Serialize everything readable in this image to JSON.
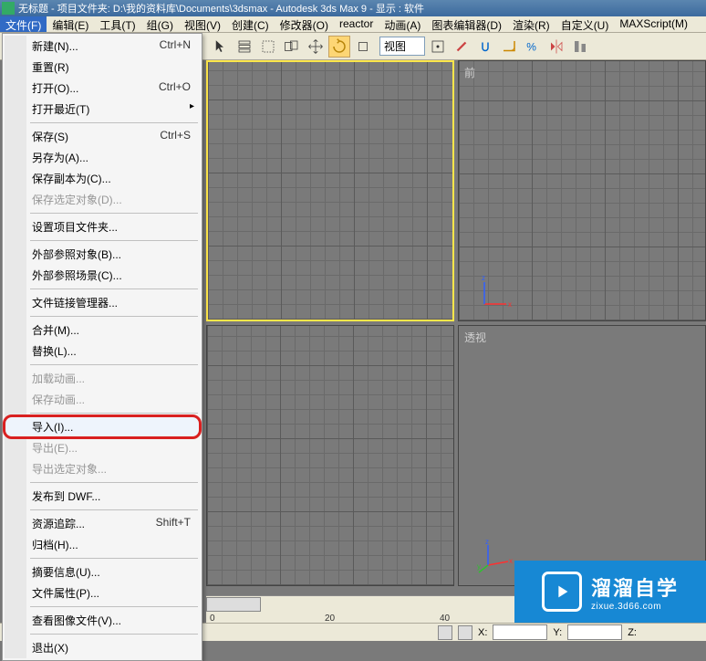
{
  "titlebar": {
    "text": "无标题    - 项目文件夹: D:\\我的资料库\\Documents\\3dsmax      - Autodesk 3ds Max 9      - 显示 : 软件"
  },
  "menubar": {
    "items": [
      {
        "label": "文件(F)",
        "active": true
      },
      {
        "label": "编辑(E)"
      },
      {
        "label": "工具(T)"
      },
      {
        "label": "组(G)"
      },
      {
        "label": "视图(V)"
      },
      {
        "label": "创建(C)"
      },
      {
        "label": "修改器(O)"
      },
      {
        "label": "reactor"
      },
      {
        "label": "动画(A)"
      },
      {
        "label": "图表编辑器(D)"
      },
      {
        "label": "渲染(R)"
      },
      {
        "label": "自定义(U)"
      },
      {
        "label": "MAXScript(M)"
      }
    ]
  },
  "toolbar": {
    "view_label": "视图"
  },
  "file_menu": {
    "items": [
      {
        "label": "新建(N)...",
        "shortcut": "Ctrl+N"
      },
      {
        "label": "重置(R)"
      },
      {
        "label": "打开(O)...",
        "shortcut": "Ctrl+O"
      },
      {
        "label": "打开最近(T)",
        "submenu": true
      },
      {
        "sep": true
      },
      {
        "label": "保存(S)",
        "shortcut": "Ctrl+S"
      },
      {
        "label": "另存为(A)..."
      },
      {
        "label": "保存副本为(C)..."
      },
      {
        "label": "保存选定对象(D)...",
        "disabled": true
      },
      {
        "sep": true
      },
      {
        "label": "设置项目文件夹..."
      },
      {
        "sep": true
      },
      {
        "label": "外部参照对象(B)..."
      },
      {
        "label": "外部参照场景(C)..."
      },
      {
        "sep": true
      },
      {
        "label": "文件链接管理器..."
      },
      {
        "sep": true
      },
      {
        "label": "合并(M)..."
      },
      {
        "label": "替换(L)..."
      },
      {
        "sep": true
      },
      {
        "label": "加载动画...",
        "disabled": true
      },
      {
        "label": "保存动画...",
        "disabled": true
      },
      {
        "sep": true
      },
      {
        "label": "导入(I)...",
        "highlighted": true
      },
      {
        "label": "导出(E)...",
        "disabled": true
      },
      {
        "label": "导出选定对象...",
        "disabled": true
      },
      {
        "sep": true
      },
      {
        "label": "发布到 DWF..."
      },
      {
        "sep": true
      },
      {
        "label": "资源追踪...",
        "shortcut": "Shift+T"
      },
      {
        "label": "归档(H)..."
      },
      {
        "sep": true
      },
      {
        "label": "摘要信息(U)..."
      },
      {
        "label": "文件属性(P)..."
      },
      {
        "sep": true
      },
      {
        "label": "查看图像文件(V)..."
      },
      {
        "sep": true
      },
      {
        "label": "退出(X)"
      }
    ]
  },
  "viewports": {
    "top_left": "",
    "top_right": "前",
    "bottom_left": "",
    "bottom_right": "透视"
  },
  "ruler": {
    "ticks": [
      "0",
      "20",
      "40"
    ]
  },
  "statusbar": {
    "x_label": "X:",
    "y_label": "Y:",
    "z_label": "Z:"
  },
  "watermark": {
    "text": "溜溜自学",
    "url": "zixue.3d66.com"
  }
}
